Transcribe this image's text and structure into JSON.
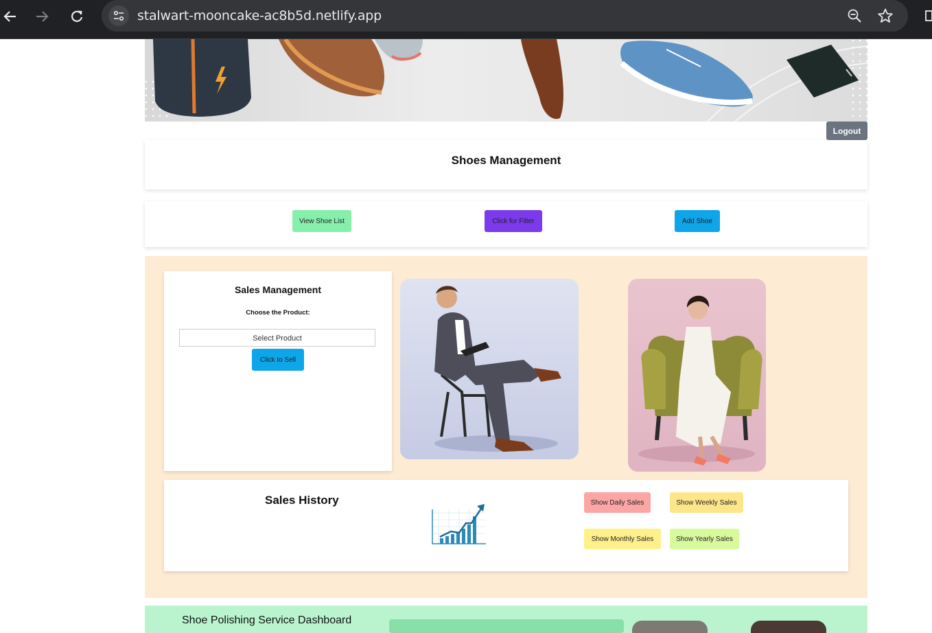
{
  "browser": {
    "url": "stalwart-mooncake-ac8b5d.netlify.app"
  },
  "header": {
    "logout_label": "Logout",
    "page_title": "Shoes Management"
  },
  "shoe_actions": {
    "view_list_label": "View Shoe List",
    "filter_label": "Click for Filter",
    "add_label": "Add Shoe"
  },
  "sales_management": {
    "title": "Sales Management",
    "choose_label": "Choose the Product:",
    "select_value": "Select Product",
    "sell_label": "Click to Sell"
  },
  "sales_history": {
    "title": "Sales History",
    "daily_label": "Show Daily Sales",
    "weekly_label": "Show Weekly Sales",
    "monthly_label": "Show Monthly Sales",
    "yearly_label": "Show Yearly Sales"
  },
  "polishing": {
    "title": "Shoe Polishing Service Dashboard"
  },
  "colors": {
    "view_list_btn": "#86efac",
    "filter_btn": "#7c3aed",
    "add_btn": "#0ea5e9",
    "sell_btn": "#0ea5e9",
    "daily_btn": "#fca5a5",
    "weekly_btn": "#fde68a",
    "monthly_btn": "#fef08a",
    "yearly_btn": "#d9f99d",
    "sales_section_bg": "#fdebd3",
    "polish_section_bg": "#b9f4cf"
  }
}
